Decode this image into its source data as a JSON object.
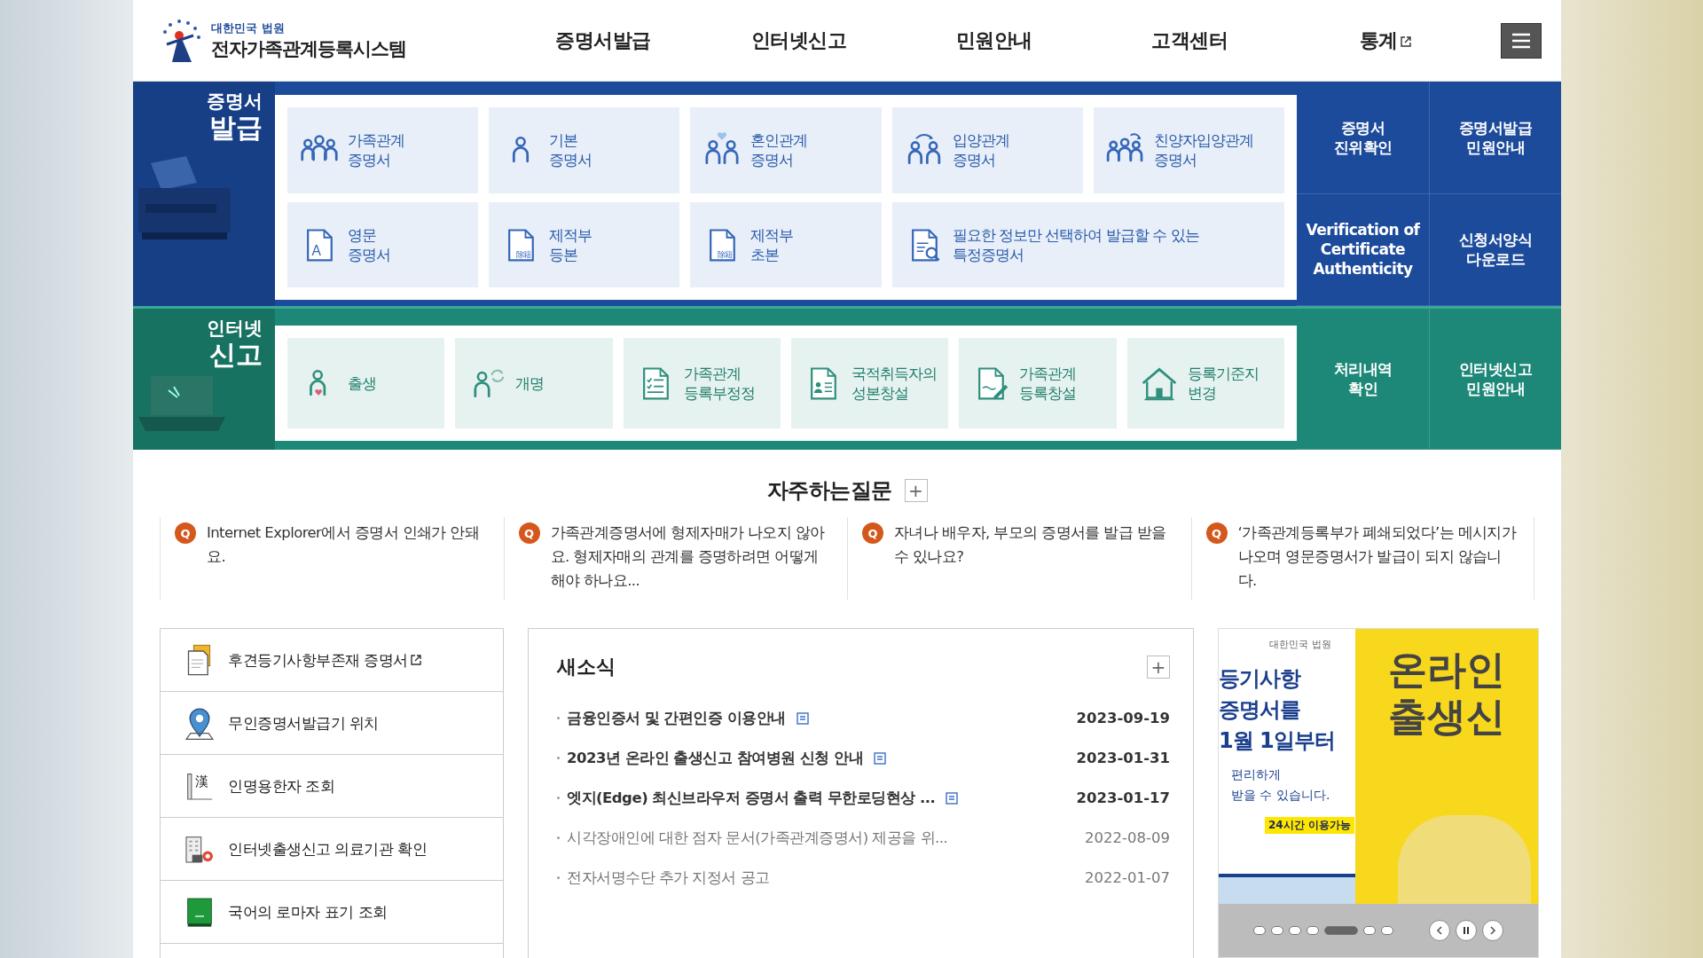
{
  "header": {
    "org": "대한민국 법원",
    "title": "전자가족관계등록시스템",
    "nav": [
      {
        "label": "증명서발급",
        "external": false
      },
      {
        "label": "인터넷신고",
        "external": false
      },
      {
        "label": "민원안내",
        "external": false
      },
      {
        "label": "고객센터",
        "external": false
      },
      {
        "label": "통계",
        "external": true
      }
    ]
  },
  "bands": [
    {
      "kind": "certificate",
      "heading": [
        "증명서",
        "발급"
      ],
      "tiles": [
        {
          "label": [
            "가족관계",
            "증명서"
          ],
          "wide": false
        },
        {
          "label": [
            "기본",
            "증명서"
          ],
          "wide": false
        },
        {
          "label": [
            "혼인관계",
            "증명서"
          ],
          "wide": false
        },
        {
          "label": [
            "입양관계",
            "증명서"
          ],
          "wide": false
        },
        {
          "label": [
            "친양자입양관계",
            "증명서"
          ],
          "wide": false
        },
        {
          "icon_text": "A",
          "label": [
            "영문",
            "증명서"
          ],
          "wide": false
        },
        {
          "icon_text": "除籍",
          "label": [
            "제적부",
            "등본"
          ],
          "wide": false
        },
        {
          "icon_text": "除籍",
          "label": [
            "제적부",
            "초본"
          ],
          "wide": false
        },
        {
          "label": [
            "필요한 정보만 선택하여 발급할 수 있는",
            "특정증명서"
          ],
          "wide": true
        }
      ],
      "side_links": [
        [
          "증명서",
          "진위확인"
        ],
        [
          "증명서발급",
          "민원안내"
        ],
        [
          "Verification of",
          "Certificate",
          "Authenticity"
        ],
        [
          "신청서양식",
          "다운로드"
        ]
      ]
    },
    {
      "kind": "report",
      "heading": [
        "인터넷",
        "신고"
      ],
      "tiles": [
        {
          "label": [
            "출생"
          ],
          "wide": false
        },
        {
          "label": [
            "개명"
          ],
          "wide": false
        },
        {
          "label": [
            "가족관계",
            "등록부정정"
          ],
          "wide": false
        },
        {
          "label": [
            "국적취득자의",
            "성본창설"
          ],
          "wide": false
        },
        {
          "label": [
            "가족관계",
            "등록창설"
          ],
          "wide": false
        },
        {
          "label": [
            "등록기준지",
            "변경"
          ],
          "wide": false
        }
      ],
      "side_links": [
        [
          "처리내역",
          "확인"
        ],
        [
          "인터넷신고",
          "민원안내"
        ]
      ]
    }
  ],
  "faq": {
    "title": "자주하는질문",
    "more": "+",
    "items": [
      {
        "marker": "Q",
        "text": "Internet Explorer에서 증명서 인쇄가 안돼요."
      },
      {
        "marker": "Q",
        "text": "가족관계증명서에 형제자매가 나오지 않아요. 형제자매의 관계를 증명하려면 어떻게 해야 하나요..."
      },
      {
        "marker": "Q",
        "text": "자녀나 배우자, 부모의 증명서를 발급 받을 수 있나요?"
      },
      {
        "marker": "Q",
        "text": "‘가족관계등록부가 폐쇄되었다’는 메시지가 나오며 영문증명서가 발급이 되지 않습니다."
      }
    ]
  },
  "quick_links": [
    {
      "label": "후견등기사항부존재 증명서",
      "external": true
    },
    {
      "label": "무인증명서발급기 위치",
      "external": false
    },
    {
      "icon_text": "漢",
      "label": "인명용한자 조회",
      "external": false
    },
    {
      "label": "인터넷출생신고 의료기관 확인",
      "external": false
    },
    {
      "label": "국어의 로마자 표기 조회",
      "external": false
    }
  ],
  "news": {
    "title": "새소식",
    "more": "+",
    "items": [
      {
        "title": "금융인증서 및 간편인증 이용안내",
        "date": "2023-09-19",
        "recent": true
      },
      {
        "title": "2023년 온라인 출생신고 참여병원 신청 안내",
        "date": "2023-01-31",
        "recent": true
      },
      {
        "title": "엣지(Edge) 최신브라우저 증명서 출력 무한로딩현상 ...",
        "date": "2023-01-17",
        "recent": true
      },
      {
        "title": "시각장애인에 대한 점자 문서(가족관계증명서) 제공을 위...",
        "date": "2022-08-09",
        "recent": false
      },
      {
        "title": "전자서명수단 추가 지정서 공고",
        "date": "2022-01-07",
        "recent": false
      }
    ]
  },
  "banner": {
    "left_slide": {
      "org": "대한민국 법원",
      "headline": [
        "등기사항",
        "증명서를",
        "1월 1일부터"
      ],
      "body": [
        "편리하게",
        "받을 수 있습니다."
      ],
      "badge": "24시간 이용가능"
    },
    "right_slide": {
      "headline": [
        "온라인",
        "출생신"
      ]
    },
    "dots": [
      {
        "selected": false
      },
      {
        "selected": false
      },
      {
        "selected": false
      },
      {
        "selected": false
      },
      {
        "selected": true
      },
      {
        "selected": false
      },
      {
        "selected": false
      }
    ]
  }
}
